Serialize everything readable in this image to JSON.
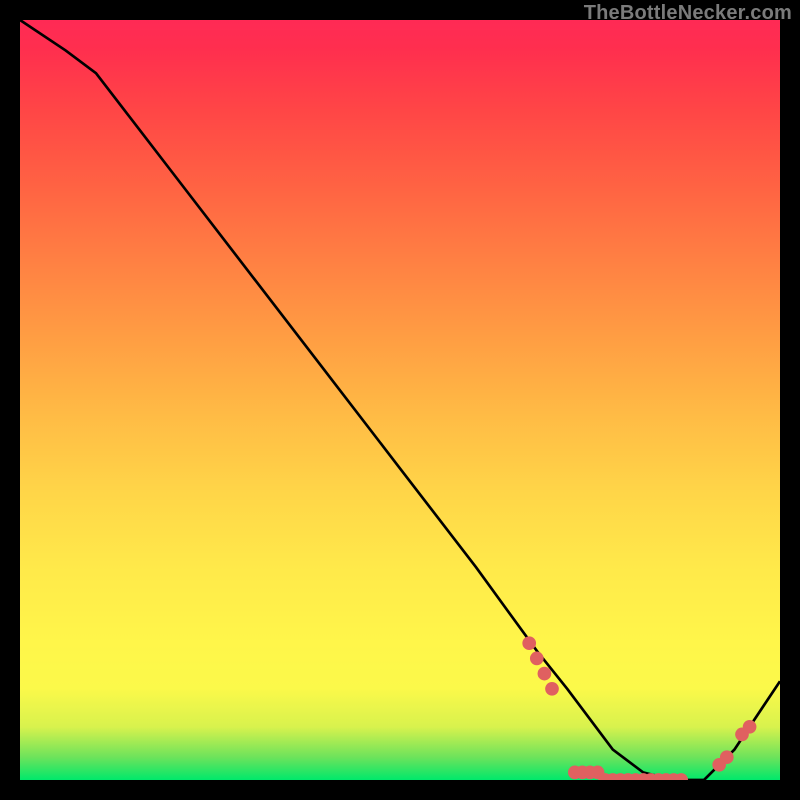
{
  "watermark": "TheBottleNecker.com",
  "chart_data": {
    "type": "line",
    "title": "",
    "xlabel": "",
    "ylabel": "",
    "xlim": [
      0,
      100
    ],
    "ylim": [
      0,
      100
    ],
    "series": [
      {
        "name": "bottleneck-curve",
        "x": [
          0,
          6,
          10,
          20,
          30,
          40,
          50,
          60,
          68,
          72,
          75,
          78,
          82,
          86,
          90,
          94,
          100
        ],
        "y": [
          100,
          96,
          93,
          80,
          67,
          54,
          41,
          28,
          17,
          12,
          8,
          4,
          1,
          0,
          0,
          4,
          13
        ]
      }
    ],
    "markers": {
      "name": "highlight-dots",
      "color": "#e06060",
      "points": [
        {
          "x": 67,
          "y": 18
        },
        {
          "x": 68,
          "y": 16
        },
        {
          "x": 69,
          "y": 14
        },
        {
          "x": 70,
          "y": 12
        },
        {
          "x": 73,
          "y": 1
        },
        {
          "x": 74,
          "y": 1
        },
        {
          "x": 75,
          "y": 1
        },
        {
          "x": 76,
          "y": 1
        },
        {
          "x": 77,
          "y": 0
        },
        {
          "x": 78,
          "y": 0
        },
        {
          "x": 79,
          "y": 0
        },
        {
          "x": 80,
          "y": 0
        },
        {
          "x": 81,
          "y": 0
        },
        {
          "x": 82,
          "y": 0
        },
        {
          "x": 83,
          "y": 0
        },
        {
          "x": 84,
          "y": 0
        },
        {
          "x": 85,
          "y": 0
        },
        {
          "x": 86,
          "y": 0
        },
        {
          "x": 87,
          "y": 0
        },
        {
          "x": 92,
          "y": 2
        },
        {
          "x": 93,
          "y": 3
        },
        {
          "x": 95,
          "y": 6
        },
        {
          "x": 96,
          "y": 7
        }
      ]
    },
    "background_gradient": {
      "direction": "bottom-to-top",
      "stops": [
        {
          "pos": 0,
          "color": "#00e86b"
        },
        {
          "pos": 12,
          "color": "#fbf94a"
        },
        {
          "pos": 50,
          "color": "#ffb045"
        },
        {
          "pos": 100,
          "color": "#ff2a55"
        }
      ]
    }
  }
}
